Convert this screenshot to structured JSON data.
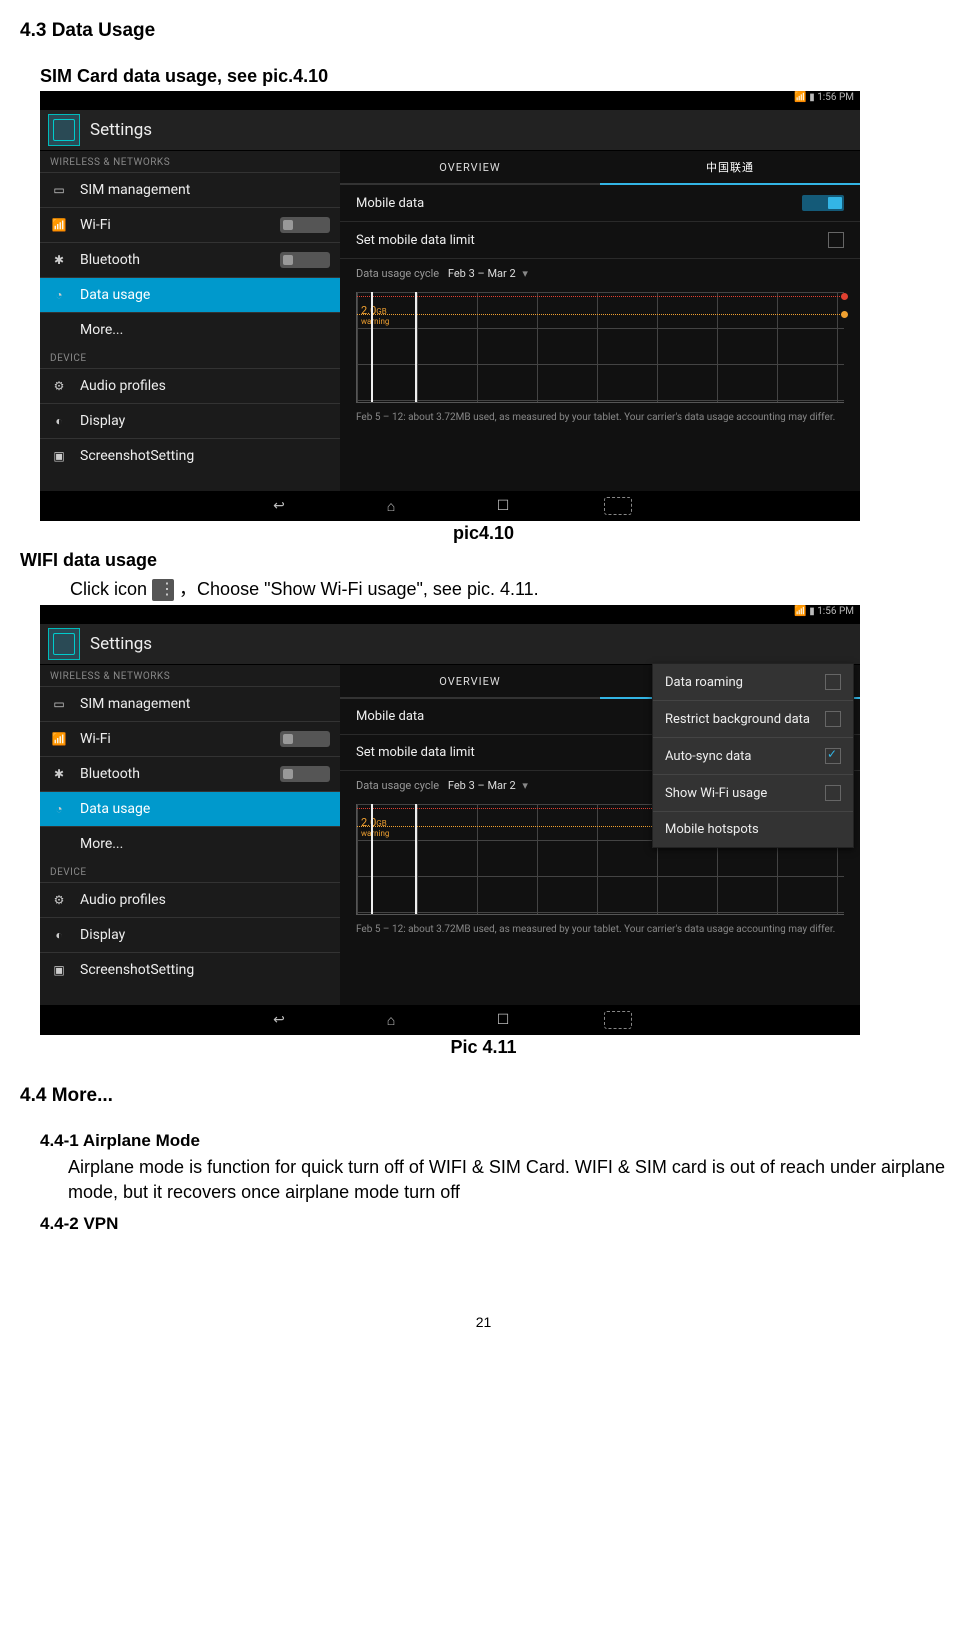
{
  "doc": {
    "h_43": "4.3 Data Usage",
    "h_sim": "SIM Card data usage, see pic.4.10",
    "cap_410": "pic4.10",
    "h_wifi": "WIFI data usage",
    "wifi_line_pre": "Click icon ",
    "wifi_line_post": "，Choose \"Show Wi-Fi usage\", see pic. 4.11.",
    "cap_411": "Pic 4.11",
    "h_44": "4.4 More...",
    "h_441": "4.4-1 Airplane Mode",
    "p_441": "Airplane mode is function for quick turn off of WIFI & SIM Card. WIFI & SIM card is out of reach under airplane mode, but it recovers once airplane mode turn off",
    "h_442": "4.4-2 VPN",
    "page_num": "21"
  },
  "shot": {
    "status_time": "1:56 PM",
    "app_title": "Settings",
    "group_wn": "WIRELESS & NETWORKS",
    "sb_sim": "SIM management",
    "sb_wifi": "Wi-Fi",
    "sb_bt": "Bluetooth",
    "sb_du": "Data usage",
    "sb_more": "More...",
    "group_dev": "DEVICE",
    "sb_audio": "Audio profiles",
    "sb_disp": "Display",
    "sb_ss": "ScreenshotSetting",
    "tab_overview": "OVERVIEW",
    "tab_carrier": "中国联通",
    "row_mobile": "Mobile data",
    "row_limit": "Set mobile data limit",
    "cycle_label": "Data usage cycle",
    "cycle_value": "Feb 3 – Mar 2",
    "chart_label": "2.0",
    "chart_sub": "warning",
    "chart_unit": "GB",
    "footer": "Feb 5 – 12: about 3.72MB used, as measured by your tablet. Your carrier's data usage accounting may differ.",
    "dd_roaming": "Data roaming",
    "dd_restrict": "Restrict background data",
    "dd_autosync": "Auto-sync data",
    "dd_showwifi": "Show Wi-Fi usage",
    "dd_hotspot": "Mobile hotspots"
  }
}
